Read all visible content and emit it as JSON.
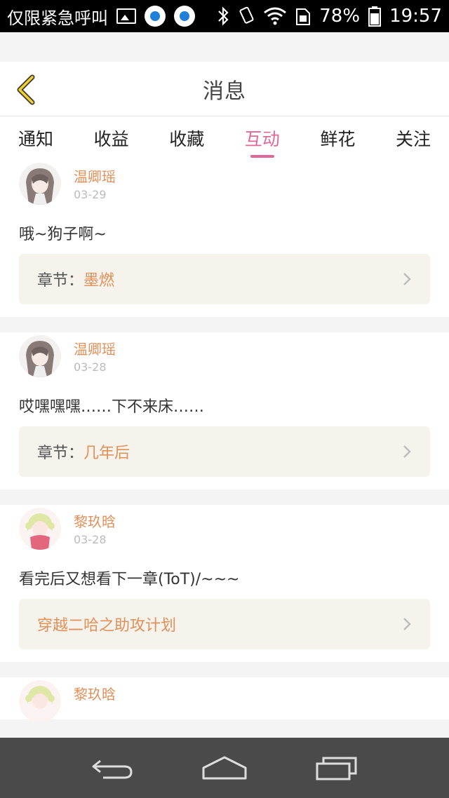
{
  "status_bar": {
    "carrier": "仅限紧急呼叫",
    "battery": "78%",
    "time": "19:57"
  },
  "header": {
    "title": "消息",
    "back_icon": "chevron-left-icon"
  },
  "tabs": [
    {
      "label": "通知",
      "active": false
    },
    {
      "label": "收益",
      "active": false
    },
    {
      "label": "收藏",
      "active": false
    },
    {
      "label": "互动",
      "active": true
    },
    {
      "label": "鲜花",
      "active": false
    },
    {
      "label": "关注",
      "active": false
    }
  ],
  "items": [
    {
      "user": "温卿瑶",
      "date": "03-29",
      "comment": "哦~狗子啊~",
      "chapter_prefix": "章节：",
      "chapter": "墨燃"
    },
    {
      "user": "温卿瑶",
      "date": "03-28",
      "comment": "哎嘿嘿嘿……下不来床……",
      "chapter_prefix": "章节：",
      "chapter": "几年后"
    },
    {
      "user": "黎玖晗",
      "date": "03-28",
      "comment": "看完后又想看下一章(ToT)/~~~",
      "chapter_prefix": "",
      "chapter": "穿越二哈之助攻计划"
    },
    {
      "user": "黎玖晗"
    }
  ],
  "colors": {
    "accent": "#e0679a",
    "username": "#e0905a"
  }
}
